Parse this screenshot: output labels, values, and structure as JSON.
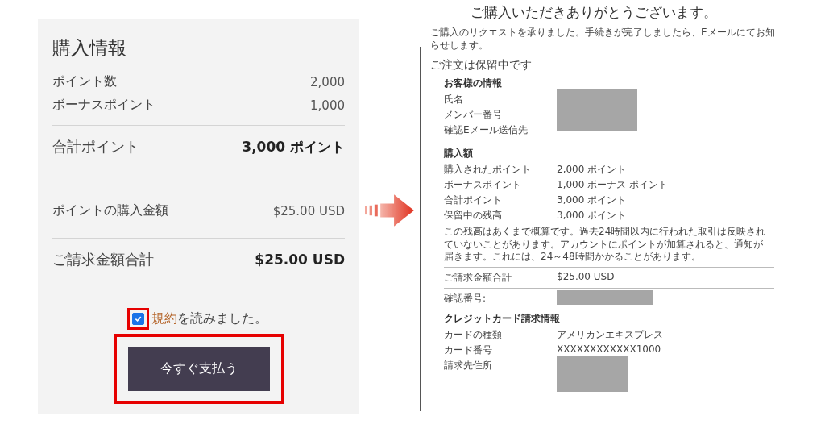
{
  "purchase_info": {
    "title": "購入情報",
    "rows": [
      {
        "label": "ポイント数",
        "value": "2,000",
        "kind": "plain",
        "rule_above": false
      },
      {
        "label": "ボーナスポイント",
        "value": "1,000",
        "kind": "plain",
        "rule_above": false
      },
      {
        "label": "合計ポイント",
        "value": "3,000 ポイント",
        "kind": "total",
        "rule_above": true
      },
      {
        "label": "ポイントの購入金額",
        "value": "$25.00 USD",
        "kind": "spaced",
        "rule_above": false
      },
      {
        "label": "ご請求金額合計",
        "value": "$25.00 USD",
        "kind": "total",
        "rule_above": true
      }
    ],
    "terms": {
      "checked": true,
      "highlighted": true,
      "link": "規約",
      "text": "を読みました。"
    },
    "pay_button": {
      "label": "今すぐ支払う",
      "highlighted": true
    }
  },
  "confirmation": {
    "title": "ご購入いただきありがとうございます。",
    "intro": "ご購入のリクエストを承りました。手続きが完了しましたら、Eメールにてお知らせします。",
    "status": "ご注文は保留中です",
    "customer": {
      "heading": "お客様の情報",
      "labels": [
        "氏名",
        "メンバー番号",
        "確認Eメール送信先"
      ],
      "redacted": true
    },
    "amount": {
      "heading": "購入額",
      "rows": [
        {
          "label": "購入されたポイント",
          "value": "2,000 ポイント"
        },
        {
          "label": "ボーナスポイント",
          "value": "1,000 ボーナス ポイント"
        },
        {
          "label": "合計ポイント",
          "value": "3,000 ポイント"
        },
        {
          "label": "保留中の残高",
          "value": "3,000 ポイント"
        }
      ],
      "note": "この残高はあくまで概算です。過去24時間以内に行われた取引は反映されていないことがあります。アカウントにポイントが加算されると、通知が届きます。これには、24～48時間かかることがあります。"
    },
    "total": {
      "label": "ご請求金額合計",
      "value": "$25.00 USD"
    },
    "confirmation_number": {
      "label": "確認番号:",
      "redacted": true
    },
    "card": {
      "heading": "クレジットカード請求情報",
      "rows": [
        {
          "label": "カードの種類",
          "value": "アメリカンエキスプレス",
          "redacted": false
        },
        {
          "label": "カード番号",
          "value": "XXXXXXXXXXXX1000",
          "redacted": false
        },
        {
          "label": "請求先住所",
          "redacted": true
        }
      ]
    }
  }
}
